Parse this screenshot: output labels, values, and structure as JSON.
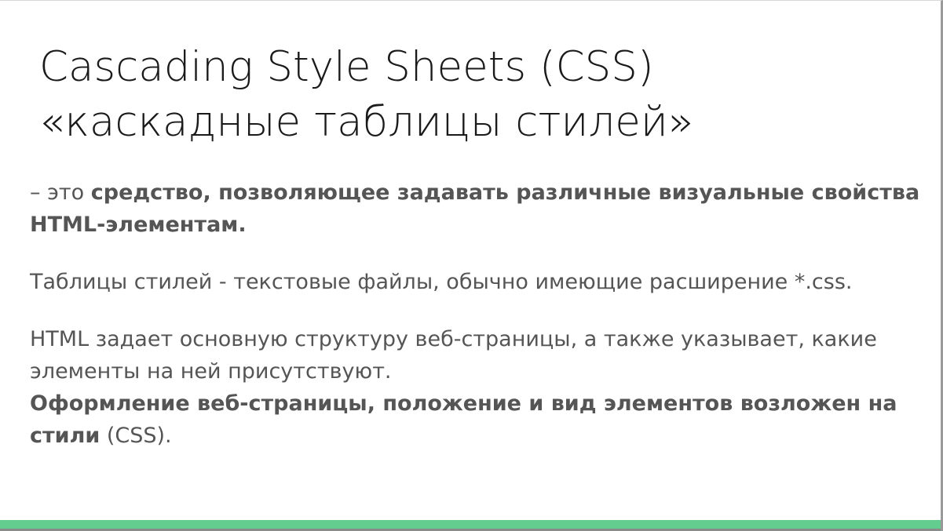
{
  "slide": {
    "title_line1": "Cascading Style Sheets (CSS)",
    "title_line2": "«каскадные таблицы стилей»",
    "definition": {
      "prefix": "– это ",
      "bold": "средство, позволяющее задавать различные визуальные свойства HTML-элементам."
    },
    "paragraph2": "Таблицы стилей - текстовые файлы, обычно имеющие расширение *.css.",
    "paragraph3_line": "HTML задает основную структуру веб-страницы, а также указывает, какие элементы на ней присутствуют.",
    "paragraph3_bold": "Оформление веб-страницы, положение и вид элементов возложен на стили",
    "paragraph3_tail": " (CSS).",
    "accent_color": "#62cd8e"
  }
}
